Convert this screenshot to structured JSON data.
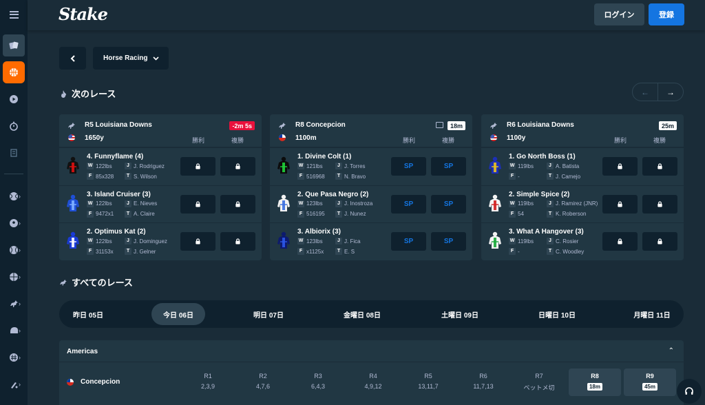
{
  "header": {
    "logo": "Stake",
    "login": "ログイン",
    "register": "登録"
  },
  "controls": {
    "sport": "Horse Racing"
  },
  "next_races": {
    "title": "次のレース",
    "cards": [
      {
        "name": "R5 Louisiana Downs",
        "distance": "1650y",
        "flag": "us",
        "time": "-2m 5s",
        "time_style": "red",
        "tv": false,
        "win_label": "勝利",
        "place_label": "複勝",
        "runners": [
          {
            "name": "4. Funnyflame",
            "no": "(4)",
            "w": "122lbs",
            "j": "J. Rodriguez",
            "f": "85x328",
            "t": "S. Wilson",
            "silk": "red-black",
            "odds": "lock"
          },
          {
            "name": "3. Island Cruiser",
            "no": "(3)",
            "w": "122lbs",
            "j": "E. Nieves",
            "f": "9472x1",
            "t": "A. Claire",
            "silk": "blue-check",
            "odds": "lock"
          },
          {
            "name": "2. Optimus Kat",
            "no": "(2)",
            "w": "122lbs",
            "j": "J. Dominguez",
            "f": "31153x",
            "t": "J. Gelner",
            "silk": "blue-white",
            "odds": "lock"
          }
        ]
      },
      {
        "name": "R8 Concepcion",
        "distance": "1100m",
        "flag": "cl",
        "time": "18m",
        "time_style": "white",
        "tv": true,
        "win_label": "勝利",
        "place_label": "複勝",
        "runners": [
          {
            "name": "1. Divine Colt",
            "no": "(1)",
            "w": "121lbs",
            "j": "J. Torres",
            "f": "516968",
            "t": "N. Bravo",
            "silk": "black-green",
            "odds": "SP"
          },
          {
            "name": "2. Que Pasa Negro",
            "no": "(2)",
            "w": "123lbs",
            "j": "J. Inostroza",
            "f": "516195",
            "t": "J. Nunez",
            "silk": "white-blue",
            "odds": "SP"
          },
          {
            "name": "3. Albiorix",
            "no": "(3)",
            "w": "123lbs",
            "j": "J. Fica",
            "f": "x1125x",
            "t": "E. S",
            "silk": "navy-blue",
            "odds": "SP"
          }
        ]
      },
      {
        "name": "R6 Louisiana Downs",
        "distance": "1100y",
        "flag": "us",
        "time": "25m",
        "time_style": "white",
        "tv": false,
        "win_label": "勝利",
        "place_label": "複勝",
        "runners": [
          {
            "name": "1. Go North Boss",
            "no": "(1)",
            "w": "119lbs",
            "j": "A. Batista",
            "f": "-",
            "t": "J. Camejo",
            "silk": "blue-gold",
            "odds": "lock"
          },
          {
            "name": "2. Simple Spice",
            "no": "(2)",
            "w": "119lbs",
            "j": "J. Ramirez (JNR)",
            "f": "54",
            "t": "K. Roberson",
            "silk": "white-red",
            "odds": "lock"
          },
          {
            "name": "3. What A Hangover",
            "no": "(3)",
            "w": "119lbs",
            "j": "C. Rosier",
            "f": "-",
            "t": "C. Woodley",
            "silk": "white-green",
            "odds": "lock"
          }
        ]
      }
    ]
  },
  "all_races": {
    "title": "すべてのレース",
    "dates": [
      "昨日 05日",
      "今日 06日",
      "明日 07日",
      "金曜日 08日",
      "土曜日 09日",
      "日曜日 10日",
      "月曜日 11日"
    ],
    "active_date": 1,
    "region": "Americas",
    "track": "Concepcion",
    "races": [
      {
        "label": "R1",
        "value": "2,3,9"
      },
      {
        "label": "R2",
        "value": "4,7,6"
      },
      {
        "label": "R3",
        "value": "6,4,3"
      },
      {
        "label": "R4",
        "value": "4,9,12"
      },
      {
        "label": "R5",
        "value": "13,11,7"
      },
      {
        "label": "R6",
        "value": "11,7,13"
      },
      {
        "label": "R7",
        "value": "ベットメ切"
      },
      {
        "label": "R8",
        "value": "18m",
        "upcoming": true
      },
      {
        "label": "R9",
        "value": "45m",
        "upcoming": true
      }
    ]
  },
  "colors": {
    "bg": "#1a2c38",
    "panel": "#213743",
    "dark": "#0f212e",
    "accent": "#1475e1",
    "orange": "#ff6b00",
    "live": "#e9113c"
  }
}
